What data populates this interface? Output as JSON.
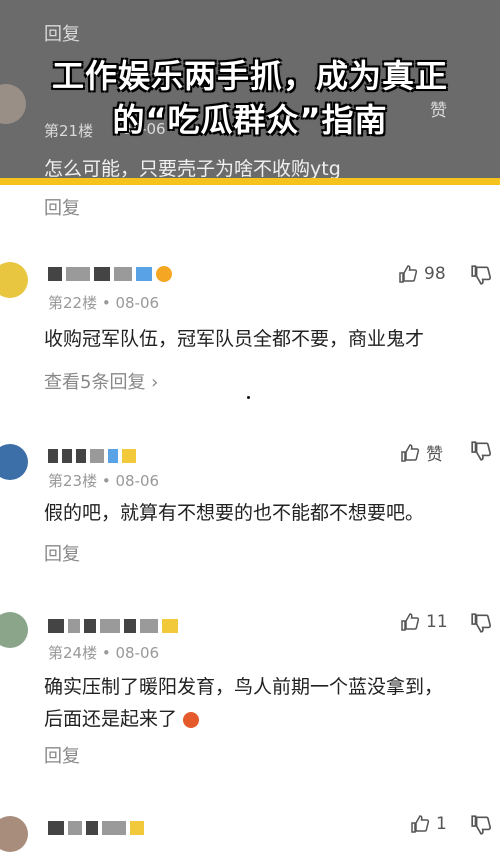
{
  "banner": {
    "title_line1": "工作娱乐两手抓，成为真正",
    "title_line2": "的“吃瓜群众”指南",
    "ghost_reply": "回复",
    "ghost_floor": "第21楼",
    "ghost_date": "08-06",
    "ghost_like": "赞"
  },
  "comments": [
    {
      "floor": "",
      "date": "",
      "text": "怎么可能，只要壳子为啥不收购ytg",
      "reply": "回复",
      "likes": ""
    },
    {
      "floor": "第22楼",
      "date": "08-06",
      "text": "收购冠军队伍，冠军队员全都不要，商业鬼才",
      "more_replies": "查看5条回复",
      "likes": "98"
    },
    {
      "floor": "第23楼",
      "date": "08-06",
      "text": "假的吧，就算有不想要的也不能都不想要吧。",
      "reply": "回复",
      "likes": "赞"
    },
    {
      "floor": "第24楼",
      "date": "08-06",
      "text_line1": "确实压制了暖阳发育，鸟人前期一个蓝没拿到，",
      "text_line2": "后面还是起来了",
      "reply": "回复",
      "likes": "11"
    },
    {
      "likes": "1"
    }
  ],
  "meta_sep": "•",
  "colors": {
    "accent": "#f6c21c",
    "banner_bg": "#6b6b6b"
  }
}
